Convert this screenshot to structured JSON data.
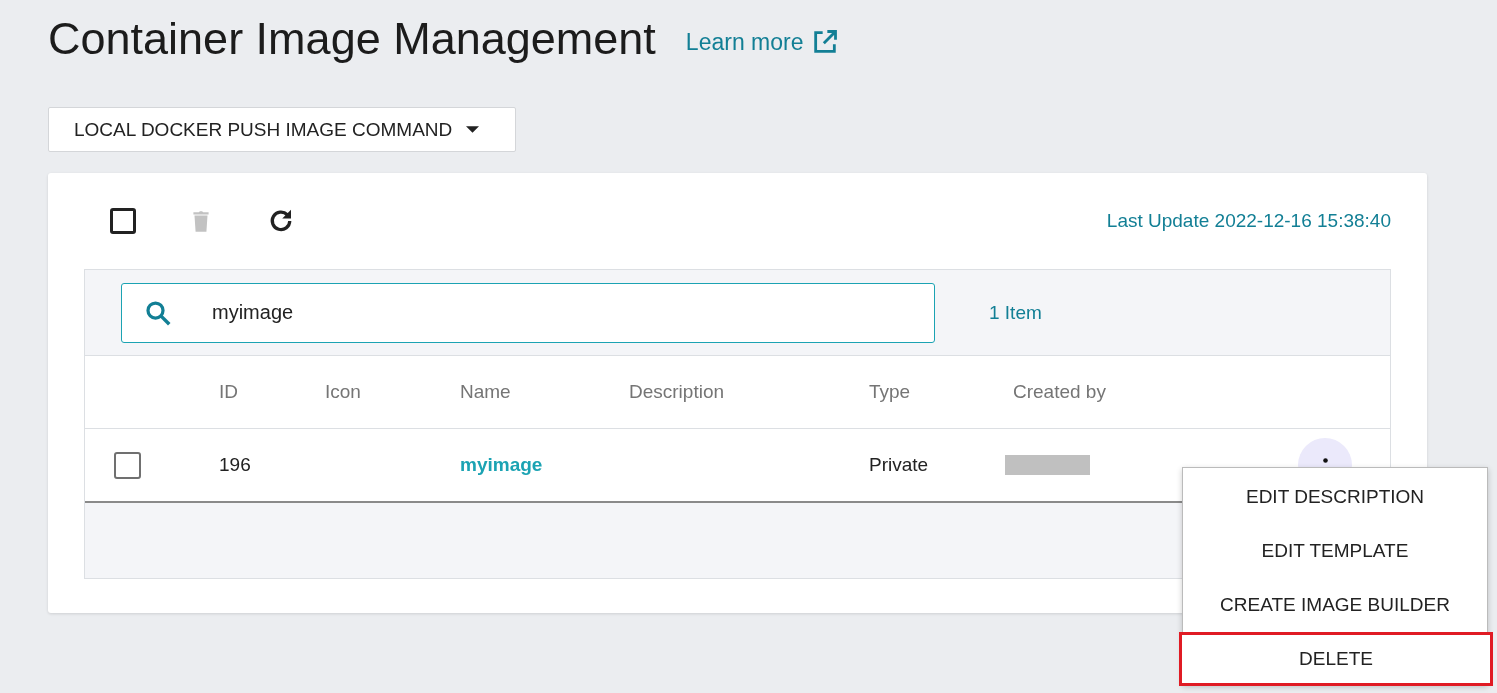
{
  "page": {
    "title": "Container Image Management",
    "learn_more": "Learn more"
  },
  "command_dropdown": {
    "label": "LOCAL DOCKER PUSH IMAGE COMMAND"
  },
  "toolbar": {
    "select_all_checked": false,
    "delete_disabled": true,
    "last_update": "Last Update 2022-12-16 15:38:40"
  },
  "search": {
    "value": "myimage",
    "count": "1 Item"
  },
  "table": {
    "columns": [
      "ID",
      "Icon",
      "Name",
      "Description",
      "Type",
      "Created by"
    ],
    "rows": [
      {
        "checked": false,
        "id": "196",
        "name": "myimage",
        "type": "Private",
        "created_by_redacted": true
      }
    ]
  },
  "menu": {
    "items": [
      {
        "label": "EDIT DESCRIPTION",
        "highlighted": false
      },
      {
        "label": "EDIT TEMPLATE",
        "highlighted": false
      },
      {
        "label": "CREATE IMAGE BUILDER",
        "highlighted": false
      },
      {
        "label": "DELETE",
        "highlighted": true
      }
    ]
  }
}
